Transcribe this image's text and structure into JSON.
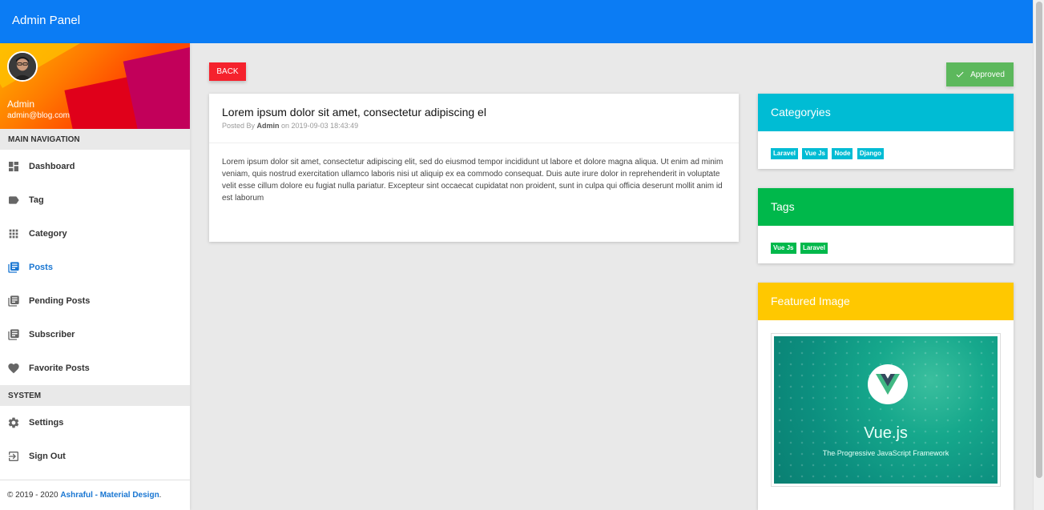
{
  "app": {
    "title": "Admin Panel"
  },
  "user": {
    "name": "Admin",
    "email": "admin@blog.com"
  },
  "sidebar": {
    "main_header": "MAIN NAVIGATION",
    "items": [
      {
        "label": "Dashboard",
        "icon": "dashboard-icon"
      },
      {
        "label": "Tag",
        "icon": "label-icon"
      },
      {
        "label": "Category",
        "icon": "apps-icon"
      },
      {
        "label": "Posts",
        "icon": "library-books-icon",
        "active": true
      },
      {
        "label": "Pending Posts",
        "icon": "library-books-icon"
      },
      {
        "label": "Subscriber",
        "icon": "library-books-icon"
      },
      {
        "label": "Favorite Posts",
        "icon": "heart-icon"
      }
    ],
    "system_header": "SYSTEM",
    "system_items": [
      {
        "label": "Settings",
        "icon": "gear-icon"
      },
      {
        "label": "Sign Out",
        "icon": "sign-out-icon"
      }
    ],
    "footer": {
      "prefix": "© 2019 - 2020 ",
      "link": "Ashraful - Material Design",
      "suffix": "."
    }
  },
  "actions": {
    "back_label": "BACK",
    "approved_label": "Approved"
  },
  "post": {
    "title": "Lorem ipsum dolor sit amet, consectetur adipiscing el",
    "posted_by_prefix": "Posted By ",
    "author": "Admin",
    "date_prefix": " on ",
    "date": "2019-09-03 18:43:49",
    "body": "Lorem ipsum dolor sit amet, consectetur adipiscing elit, sed do eiusmod tempor incididunt ut labore et dolore magna aliqua. Ut enim ad minim veniam, quis nostrud exercitation ullamco laboris nisi ut aliquip ex ea commodo consequat. Duis aute irure dolor in reprehenderit in voluptate velit esse cillum dolore eu fugiat nulla pariatur. Excepteur sint occaecat cupidatat non proident, sunt in culpa qui officia deserunt mollit anim id est laborum"
  },
  "categories": {
    "title": "Categoryies",
    "items": [
      "Laravel",
      "Vue Js",
      "Node",
      "Django"
    ]
  },
  "tags": {
    "title": "Tags",
    "items": [
      "Vue Js",
      "Laravel"
    ]
  },
  "featured": {
    "title": "Featured Image",
    "image_title": "Vue.js",
    "image_subtitle": "The Progressive JavaScript Framework"
  },
  "colors": {
    "topbar": "#0b7cf4",
    "back": "#f5222d",
    "approved": "#5cb85c",
    "categories": "#00bcd4",
    "tags": "#00b84b",
    "featured": "#ffc800",
    "active_nav": "#1976d2"
  }
}
